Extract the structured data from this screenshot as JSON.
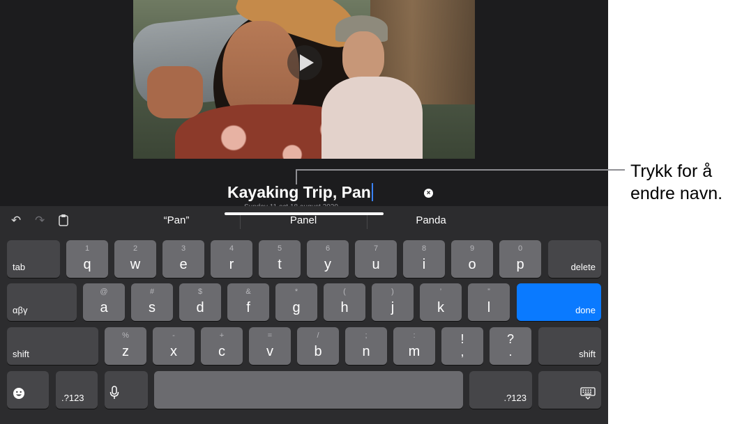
{
  "editor": {
    "title_text": "Kayaking Trip, Pan",
    "subtitle_text": "Sunday 11 oct 18 august 2020",
    "play_icon": "play-icon",
    "clear_icon": "clear-icon"
  },
  "toolbar": {
    "undo_icon": "undo-icon",
    "redo_icon": "redo-icon",
    "paste_icon": "clipboard-icon",
    "suggestions": [
      "“Pan”",
      "Panel",
      "Panda"
    ]
  },
  "keyboard": {
    "row1": [
      {
        "main": "q",
        "alt": "1"
      },
      {
        "main": "w",
        "alt": "2"
      },
      {
        "main": "e",
        "alt": "3"
      },
      {
        "main": "r",
        "alt": "4"
      },
      {
        "main": "t",
        "alt": "5"
      },
      {
        "main": "y",
        "alt": "6"
      },
      {
        "main": "u",
        "alt": "7"
      },
      {
        "main": "i",
        "alt": "8"
      },
      {
        "main": "o",
        "alt": "9"
      },
      {
        "main": "p",
        "alt": "0"
      }
    ],
    "row2": [
      {
        "main": "a",
        "alt": "@"
      },
      {
        "main": "s",
        "alt": "#"
      },
      {
        "main": "d",
        "alt": "$"
      },
      {
        "main": "f",
        "alt": "&"
      },
      {
        "main": "g",
        "alt": "*"
      },
      {
        "main": "h",
        "alt": "("
      },
      {
        "main": "j",
        "alt": ")"
      },
      {
        "main": "k",
        "alt": "’"
      },
      {
        "main": "l",
        "alt": "”"
      }
    ],
    "row3": [
      {
        "main": "z",
        "alt": "%"
      },
      {
        "main": "x",
        "alt": "-"
      },
      {
        "main": "c",
        "alt": "+"
      },
      {
        "main": "v",
        "alt": "="
      },
      {
        "main": "b",
        "alt": "/"
      },
      {
        "main": "n",
        "alt": ";"
      },
      {
        "main": "m",
        "alt": ":"
      }
    ],
    "punct": [
      {
        "top": "!",
        "bottom": ","
      },
      {
        "top": "?",
        "bottom": "."
      }
    ],
    "tab_label": "tab",
    "delete_label": "delete",
    "greek_label": "αβγ",
    "done_label": "done",
    "shift_label": "shift",
    "numbers_label": ".?123",
    "emoji_icon": "emoji-icon",
    "mic_icon": "microphone-icon",
    "hide_keyboard_icon": "keyboard-dismiss-icon"
  },
  "callout": {
    "line1": "Trykk for å",
    "line2": "endre navn."
  }
}
